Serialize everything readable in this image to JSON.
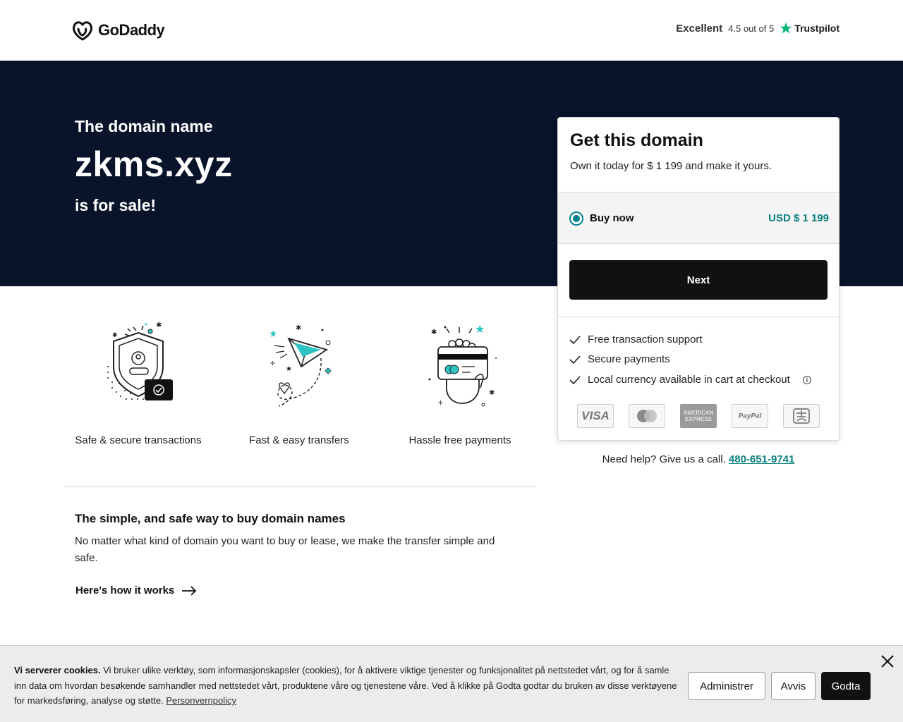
{
  "header": {
    "logo_text": "GoDaddy",
    "trust_excellent": "Excellent",
    "trust_rating": "4.5 out of 5",
    "trust_brand": "Trustpilot"
  },
  "hero": {
    "pre": "The domain name",
    "domain": "zkms.xyz",
    "post": "is for sale!"
  },
  "card": {
    "title": "Get this domain",
    "subtitle": "Own it today for $ 1 199 and make it yours.",
    "option_label": "Buy now",
    "option_price": "USD $ 1 199",
    "next_label": "Next",
    "features": [
      "Free transaction support",
      "Secure payments",
      "Local currency available in cart at checkout"
    ],
    "payment_methods": {
      "visa": "VISA",
      "mastercard": "mastercard-icon",
      "amex": "AMERICAN EXPRESS",
      "paypal": "PayPal",
      "alipay": "alipay-icon"
    }
  },
  "help": {
    "text": "Need help? Give us a call.",
    "phone": "480-651-9741"
  },
  "features": [
    {
      "label": "Safe & secure transactions",
      "icon": "shield-icon"
    },
    {
      "label": "Fast & easy transfers",
      "icon": "paper-plane-icon"
    },
    {
      "label": "Hassle free payments",
      "icon": "card-hand-icon"
    }
  ],
  "info": {
    "title": "The simple, and safe way to buy domain names",
    "body": "No matter what kind of domain you want to buy or lease, we make the transfer simple and safe.",
    "link": "Here's how it works"
  },
  "cookie": {
    "lead": "Vi serverer cookies.",
    "text": " Vi bruker ulike verktøy, som informasjonskapsler (cookies), for å aktivere viktige tjenester og funksjonalitet på nettstedet vårt, og for å samle inn data om hvordan besøkende samhandler med nettstedet vårt, produktene våre og tjenestene våre. Ved å klikke på Godta godtar du bruken av disse verktøyene for markedsføring, analyse og støtte. ",
    "policy_link": "Personvernpolicy",
    "manage": "Administrer",
    "reject": "Avvis",
    "accept": "Godta"
  },
  "colors": {
    "hero_bg": "#09142b",
    "accent": "#0a8080",
    "button_dark": "#111111"
  }
}
